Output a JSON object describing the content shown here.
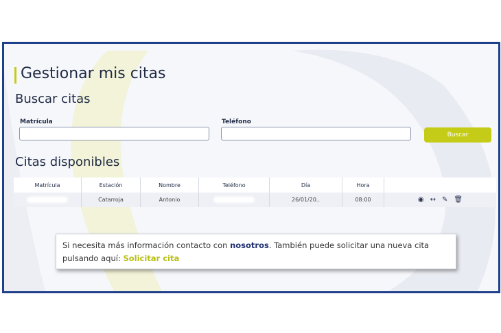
{
  "page": {
    "title": "Gestionar mis citas",
    "search_heading": "Buscar citas",
    "available_heading": "Citas disponibles"
  },
  "search": {
    "plate_label": "Matrícula",
    "plate_value": "",
    "phone_label": "Teléfono",
    "phone_value": "",
    "button_label": "Buscar"
  },
  "table": {
    "headers": [
      "Matrícula",
      "Estación",
      "Nombre",
      "Teléfono",
      "Día",
      "Hora"
    ],
    "rows": [
      {
        "plate": "",
        "station": "Catarroja",
        "name": "Antonio",
        "phone": "",
        "day": "26/01/20..",
        "time": "08:00"
      }
    ]
  },
  "info": {
    "text1": "Si necesita más información contacto con ",
    "link1": "nosotros",
    "text2": ". También puede solicitar una nueva cita pulsando aquí: ",
    "link2": "Solicitar cita"
  },
  "colors": {
    "accent": "#c4cc17",
    "frame": "#1e3f8a",
    "text": "#1f2a44"
  }
}
